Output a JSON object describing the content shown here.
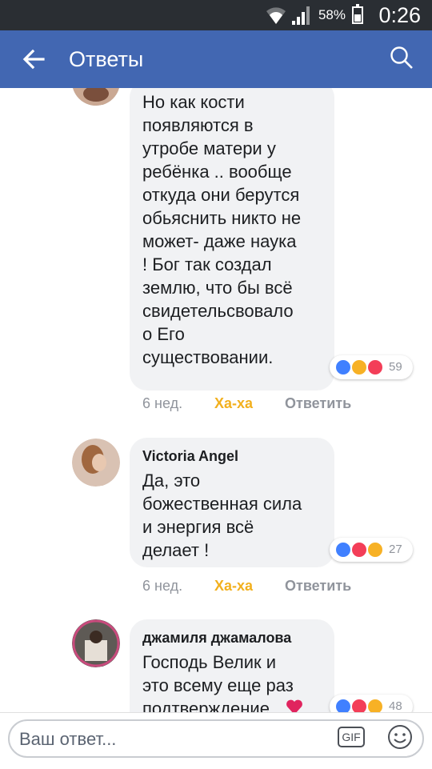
{
  "status_bar": {
    "battery_percent": "58%",
    "battery_level": 0.58,
    "time": "0:26"
  },
  "app_bar": {
    "title": "Ответы",
    "back_icon": "arrow-left-icon",
    "search_icon": "search-icon"
  },
  "comments": [
    {
      "author": "",
      "text": "Но как кости\nпоявляются в\nутробе матери у\nребёнка .. вообще\nоткуда они берутся\nобьяснить никто не\nможет- даже наука\n! Бог так создал\nземлю, что бы всё\nсвидетельсвовало\nо Его\nсуществовании.",
      "reactions": [
        "like",
        "laugh",
        "love"
      ],
      "reaction_count": "59",
      "time": "6 нед.",
      "haha": "Ха-ха",
      "reply": "Ответить"
    },
    {
      "author": "Victoria Angel",
      "text": "Да, это\nбожественная сила\nи энергия всё\nделает !",
      "reactions": [
        "like",
        "love",
        "laugh"
      ],
      "reaction_count": "27",
      "time": "6 нед.",
      "haha": "Ха-ха",
      "reply": "Ответить"
    },
    {
      "author": "джамиля джамалова",
      "text": "Господь Велик и\nэто всему еще раз\nподтверждение",
      "reactions": [
        "like",
        "love",
        "laugh"
      ],
      "reaction_count": "48"
    }
  ],
  "composer": {
    "placeholder": "Ваш ответ...",
    "gif_label": "GIF",
    "emoji_icon": "smiley-icon"
  },
  "colors": {
    "brand": "#4267b2",
    "status_bar": "#2a2e33",
    "bubble": "#f1f2f4",
    "haha": "#f2b01e",
    "like": "#4080ff",
    "love": "#f33e58",
    "laugh": "#f7b125"
  }
}
